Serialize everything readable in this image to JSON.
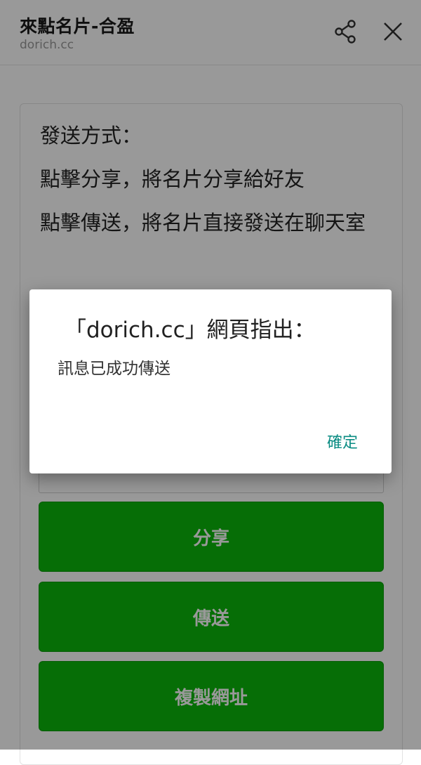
{
  "appbar": {
    "title": "來點名片-合盈",
    "subtitle": "dorich.cc",
    "share_icon": "share-icon",
    "close_icon": "close-icon"
  },
  "card": {
    "line1": "發送方式：",
    "line2": "點擊分享，將名片分享給好友",
    "line3": "點擊傳送，將名片直接發送在聊天室"
  },
  "buttons": {
    "share": "分享",
    "send": "傳送",
    "copy_url": "複製網址"
  },
  "dialog": {
    "title": "「dorich.cc」網頁指出：",
    "message": "訊息已成功傳送",
    "ok": "確定"
  },
  "colors": {
    "button_green": "#0bb70b",
    "dialog_action": "#0b8c83"
  }
}
